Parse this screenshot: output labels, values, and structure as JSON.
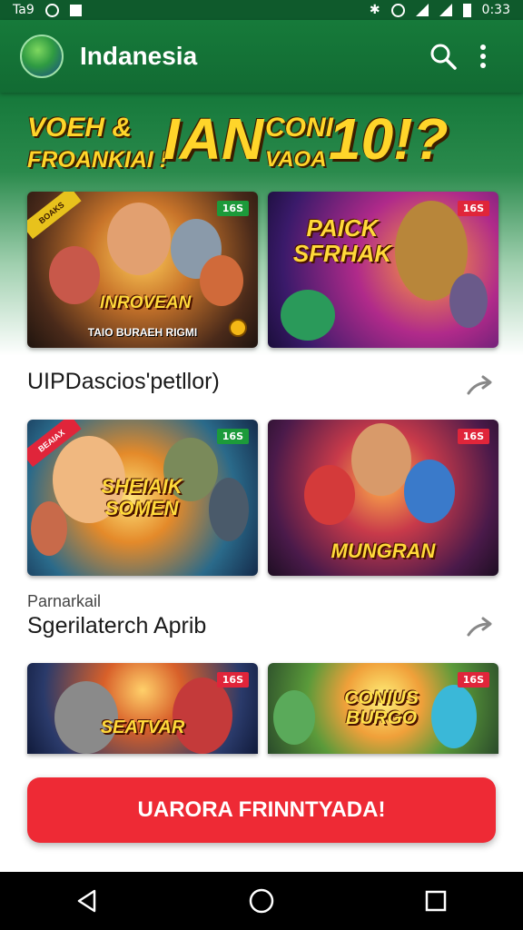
{
  "status_bar": {
    "left_text": "Ta9",
    "time": "0:33"
  },
  "header": {
    "title": "Indanesia"
  },
  "promo": {
    "line1_a": "VOEH &",
    "line2_a": "FROANKIAI !",
    "big_a": "IAN",
    "line1_b": "CONI",
    "line2_b": "VAOA",
    "big_b": "10!?"
  },
  "cards": [
    {
      "title": "INROVEAN",
      "subtitle": "TAIO BURAEH RIGMI",
      "badge": "16S",
      "badge_color": "#1c9a3a",
      "corner": "BOAKS"
    },
    {
      "title": "PAICK SFRHAK",
      "subtitle": "",
      "badge": "16S",
      "badge_color": "#e0253a"
    },
    {
      "title": "SHEIAIK SOMEN",
      "subtitle": "",
      "badge": "16S",
      "badge_color": "#1c9a3a",
      "corner": "BEAIAX"
    },
    {
      "title": "MUNGRAN",
      "subtitle": "",
      "badge": "16S",
      "badge_color": "#e0253a"
    },
    {
      "title": "SEATVAR",
      "subtitle": "",
      "badge": "16S",
      "badge_color": "#e0253a"
    },
    {
      "title": "CONIUS BURGO",
      "subtitle": "",
      "badge": "16S",
      "badge_color": "#e0253a"
    }
  ],
  "section1": {
    "title": "UIPDascios'petllor)"
  },
  "section2": {
    "subtitle": "Parnarkail",
    "title": "Sgerilaterch Aprib"
  },
  "cta": {
    "label": "UARORA FRINNTYADA!"
  },
  "icons": {
    "search": "search-icon",
    "more": "more-vert-icon",
    "arrow": "share-arrow-icon",
    "back": "back-triangle-icon",
    "home": "home-circle-icon",
    "recents": "recents-square-icon"
  },
  "colors": {
    "header_green": "#167a3a",
    "cta_red": "#ee2a35",
    "title_gold": "#ffd52a"
  }
}
